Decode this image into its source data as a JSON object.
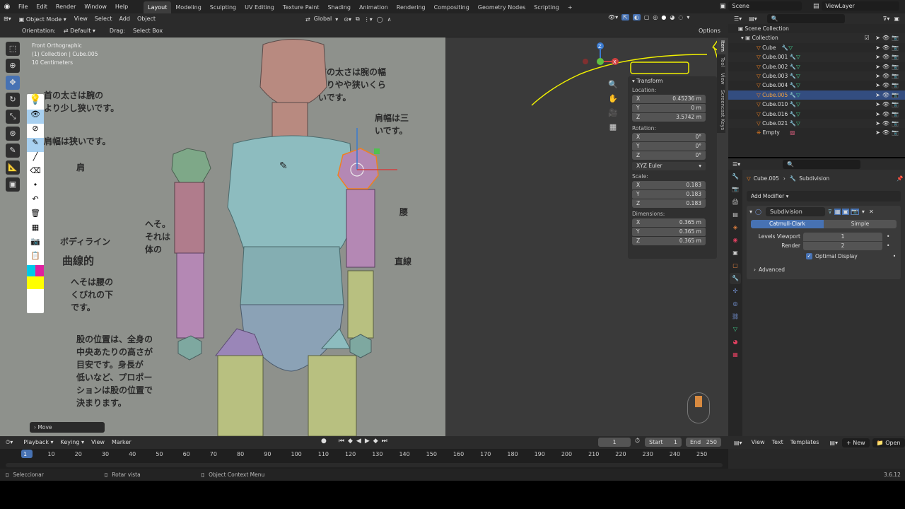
{
  "topbar": {
    "menus": [
      "File",
      "Edit",
      "Render",
      "Window",
      "Help"
    ],
    "workspaces": [
      "Layout",
      "Modeling",
      "Sculpting",
      "UV Editing",
      "Texture Paint",
      "Shading",
      "Animation",
      "Rendering",
      "Compositing",
      "Geometry Nodes",
      "Scripting"
    ],
    "active_workspace": "Layout",
    "add_tab": "+",
    "scene": "Scene",
    "view_layer": "ViewLayer"
  },
  "viewport_header": {
    "mode": "Object Mode",
    "menus": [
      "View",
      "Select",
      "Add",
      "Object"
    ],
    "transform_orientation": "Global"
  },
  "tool_settings": {
    "orientation_label": "Orientation:",
    "orientation_value": "Default",
    "drag_label": "Drag:",
    "drag_value": "Select Box",
    "options": "Options"
  },
  "viewport": {
    "view_name": "Front Orthographic",
    "collection_info": "(1) Collection | Cube.005",
    "scale": "10 Centimeters",
    "last_operator": "Move",
    "jp_texts": [
      "首の太さは腕の",
      "より少し狭いです。",
      "肩幅は狭いです。",
      "首の太さは腕の幅",
      "よりやや狭いくら",
      "いです。",
      "肩幅は三",
      "いです。",
      "へそ。",
      "それは",
      "体の",
      "ボディライン",
      "曲線的",
      "へそは腰の",
      "くびれの下",
      "です。",
      "股の位置は、全身の",
      "中央あたりの高さが",
      "目安です。身長が",
      "低いなど、プロポー",
      "ションは股の位置で",
      "決まります。",
      "肩",
      "腰",
      "直線"
    ]
  },
  "npanel": {
    "section": "Transform",
    "location_label": "Location:",
    "location": {
      "x": "0.45236 m",
      "y": "0 m",
      "z": "3.5742 m"
    },
    "rotation_label": "Rotation:",
    "rotation": {
      "x": "0°",
      "y": "0°",
      "z": "0°"
    },
    "rotation_mode": "XYZ Euler",
    "scale_label": "Scale:",
    "scale": {
      "x": "0.183",
      "y": "0.183",
      "z": "0.183"
    },
    "dimensions_label": "Dimensions:",
    "dimensions": {
      "x": "0.365 m",
      "y": "0.365 m",
      "z": "0.365 m"
    },
    "axis": {
      "x": "X",
      "y": "Y",
      "z": "Z"
    },
    "tabs": [
      "Item",
      "Tool",
      "View",
      "Screencast Keys"
    ]
  },
  "outliner": {
    "scene_collection": "Scene Collection",
    "collection": "Collection",
    "items": [
      "Cube",
      "Cube.001",
      "Cube.002",
      "Cube.003",
      "Cube.004",
      "Cube.005",
      "Cube.010",
      "Cube.016",
      "Cube.021",
      "Empty"
    ],
    "selected": "Cube.005"
  },
  "properties": {
    "breadcrumb_object": "Cube.005",
    "breadcrumb_modifier": "Subdivision",
    "add_modifier": "Add Modifier",
    "modifier_name": "Subdivision",
    "mode_catmull": "Catmull-Clark",
    "mode_simple": "Simple",
    "levels_viewport_label": "Levels Viewport",
    "levels_viewport_value": "1",
    "render_label": "Render",
    "render_value": "2",
    "optimal_display": "Optimal Display",
    "advanced": "Advanced"
  },
  "timeline": {
    "menus": [
      "Playback",
      "Keying",
      "View",
      "Marker"
    ],
    "current_frame": "1",
    "start_label": "Start",
    "start": "1",
    "end_label": "End",
    "end": "250",
    "ticks": [
      "1",
      "10",
      "20",
      "30",
      "40",
      "50",
      "60",
      "70",
      "80",
      "90",
      "100",
      "110",
      "120",
      "130",
      "140",
      "150",
      "160",
      "170",
      "180",
      "190",
      "200",
      "210",
      "220",
      "230",
      "240",
      "250"
    ]
  },
  "text_editor": {
    "menus": [
      "View",
      "Text",
      "Templates"
    ],
    "new": "New",
    "open": "Open"
  },
  "statusbar": {
    "select": "Seleccionar",
    "rotate": "Rotar vista",
    "context": "Object Context Menu",
    "version": "3.6.12"
  },
  "colors": {
    "accent": "#4772b3",
    "selected_row": "#334d80",
    "annotation": "#f0f000",
    "object_orange": "#f08020"
  }
}
